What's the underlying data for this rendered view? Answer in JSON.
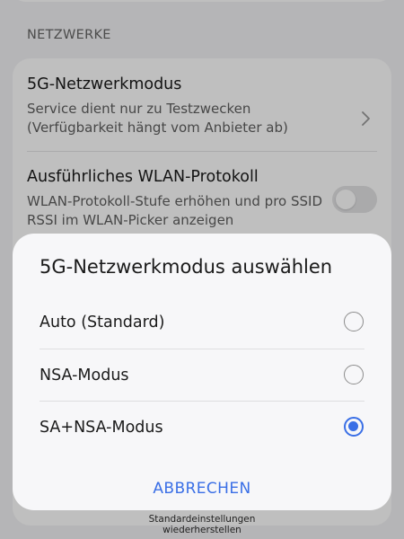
{
  "section": {
    "header": "NETZWERKE"
  },
  "settings": [
    {
      "title": "5G-Netzwerkmodus",
      "subtitle": "Service dient nur zu Testzwecken (Verfügbarkeit hängt vom Anbieter ab)",
      "control": "chevron-right-icon"
    },
    {
      "title": "Ausführliches WLAN-Protokoll",
      "subtitle": "WLAN-Protokoll-Stufe erhöhen und pro SSID RSSI im WLAN-Picker anzeigen",
      "control": "toggle",
      "enabled": false
    }
  ],
  "footer": {
    "line1": "Standardeinstellungen",
    "line2": "wiederherstellen"
  },
  "dialog": {
    "title": "5G-Netzwerkmodus auswählen",
    "options": [
      {
        "label": "Auto (Standard)",
        "selected": false
      },
      {
        "label": "NSA-Modus",
        "selected": false
      },
      {
        "label": "SA+NSA-Modus",
        "selected": true
      }
    ],
    "cancel_label": "ABBRECHEN"
  },
  "colors": {
    "accent": "#3a6fe6",
    "background": "#f2f2f4",
    "card": "#ffffff"
  }
}
